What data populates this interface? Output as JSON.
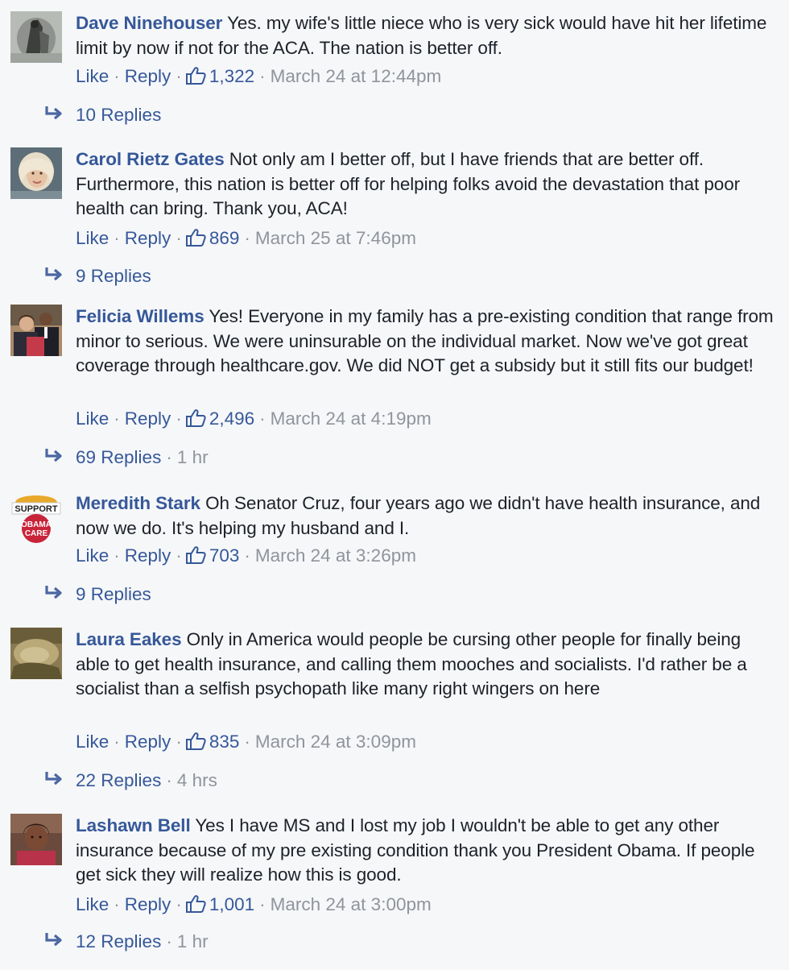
{
  "ui": {
    "like_label": "Like",
    "reply_label": "Reply",
    "separator": "·"
  },
  "colors": {
    "link": "#365899",
    "meta_gray": "#90949c",
    "text": "#1d2129",
    "background": "#f6f7f9"
  },
  "comments": [
    {
      "author": "Dave Ninehouser",
      "text": "Yes. my wife's little niece who is very sick would have hit her lifetime limit by now if not for the ACA. The nation is better off.",
      "likes": "1,322",
      "timestamp": "March 24 at 12:44pm",
      "replies_label": "10 Replies",
      "replies_time": "",
      "avatar_icon": "avatar-photo-icon"
    },
    {
      "author": "Carol Rietz Gates",
      "text": "Not only am I better off, but I have friends that are better off. Furthermore, this nation is better off for helping folks avoid the devastation that poor health can bring. Thank you, ACA!",
      "likes": "869",
      "timestamp": "March 25 at 7:46pm",
      "replies_label": "9 Replies",
      "replies_time": "",
      "avatar_icon": "avatar-photo-icon"
    },
    {
      "author": "Felicia Willems",
      "text": "Yes! Everyone in my family has a pre-existing condition that range from minor to serious. We were uninsurable on the individual market. Now we've got great coverage through healthcare.gov. We did NOT get a subsidy but it still fits our budget!",
      "likes": "2,496",
      "timestamp": "March 24 at 4:19pm",
      "replies_label": "69 Replies",
      "replies_time": "1 hr",
      "avatar_icon": "avatar-photo-icon"
    },
    {
      "author": "Meredith Stark",
      "text": "Oh Senator Cruz, four years ago we didn't have health insurance, and now we do. It's helping my husband and I.",
      "likes": "703",
      "timestamp": "March 24 at 3:26pm",
      "replies_label": "9 Replies",
      "replies_time": "",
      "avatar_icon": "support-obamacare-badge-icon",
      "avatar_text": {
        "line1": "SUPPORT",
        "line2": "OBAMA",
        "line3": "CARE"
      }
    },
    {
      "author": "Laura Eakes",
      "text": "Only in America would people be cursing other people for finally being able to get health insurance, and calling them mooches and socialists. I'd rather be a socialist than a selfish psychopath like many right wingers on here",
      "likes": "835",
      "timestamp": "March 24 at 3:09pm",
      "replies_label": "22 Replies",
      "replies_time": "4 hrs",
      "avatar_icon": "avatar-photo-icon"
    },
    {
      "author": "Lashawn Bell",
      "text": "Yes I have MS and I lost my job I wouldn't be able to get any other insurance because of my pre existing condition thank you President Obama. If people get sick they will realize how this is good.",
      "likes": "1,001",
      "timestamp": "March 24 at 3:00pm",
      "replies_label": "12 Replies",
      "replies_time": "1 hr",
      "avatar_icon": "avatar-photo-icon"
    }
  ]
}
